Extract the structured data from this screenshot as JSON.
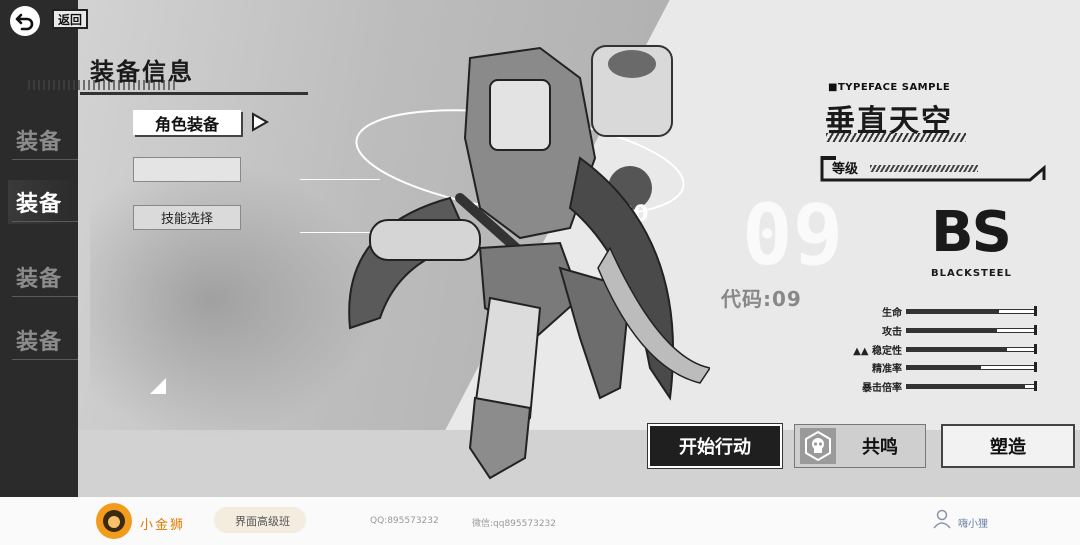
{
  "nav": {
    "back_label": "返回"
  },
  "sidebar": {
    "tabs": [
      {
        "label": "装备",
        "active": false
      },
      {
        "label": "装备",
        "active": true
      },
      {
        "label": "装备",
        "active": false
      },
      {
        "label": "装备",
        "active": false
      }
    ]
  },
  "header": {
    "title": "装备信息"
  },
  "menu": {
    "role_equip": "角色装备",
    "empty_slot": "",
    "skill_select": "技能选择"
  },
  "character": {
    "typeface_sample": "■TYPEFACE SAMPLE",
    "name": "垂直天空",
    "level_label": "等级",
    "code": "代码:09",
    "logo_letters": "BS",
    "logo_sub": "BLACKSTEEL"
  },
  "stats": [
    {
      "label": "生命",
      "value": 0.72
    },
    {
      "label": "攻击",
      "value": 0.7
    },
    {
      "label": "▲▲ 稳定性",
      "value": 0.78
    },
    {
      "label": "精准率",
      "value": 0.58
    },
    {
      "label": "暴击倍率",
      "value": 0.92
    }
  ],
  "actions": {
    "start": "开始行动",
    "resonate": "共鸣",
    "forge": "塑造"
  },
  "footer": {
    "brand": "小金狮",
    "course": "界面高级班",
    "qq": "QQ:895573232",
    "wechat": "微信:qq895573232",
    "user": "嗨小狸"
  },
  "colors": {
    "accent_dark": "#1f1f1f",
    "brand_orange": "#f29b1c",
    "sidebar": "#2b2b2b"
  },
  "icons": [
    "back-arrow-icon",
    "play-arrow-icon",
    "skull-icon",
    "user-icon",
    "lion-logo-icon"
  ]
}
